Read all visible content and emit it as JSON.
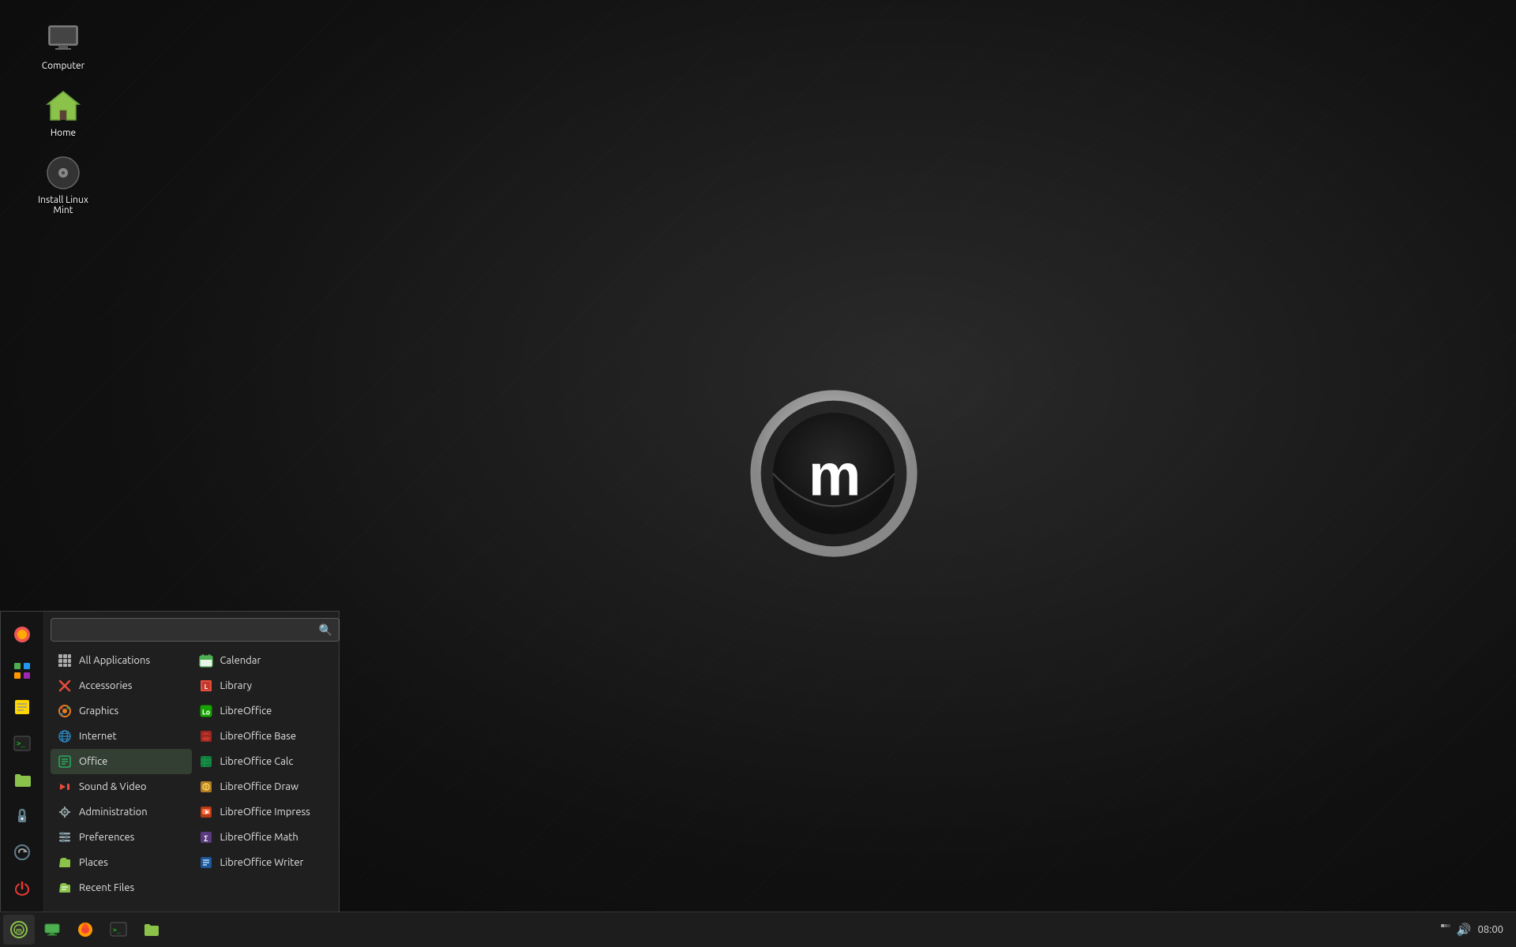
{
  "desktop": {
    "icons": [
      {
        "id": "computer",
        "label": "Computer",
        "icon": "🖥"
      },
      {
        "id": "home",
        "label": "Home",
        "icon": "🏠"
      },
      {
        "id": "install",
        "label": "Install Linux Mint",
        "icon": "💿"
      }
    ]
  },
  "taskbar": {
    "time": "08:00",
    "buttons": [
      {
        "id": "mint-menu",
        "icon": "🌿",
        "active": true
      },
      {
        "id": "show-desktop",
        "icon": "🟩",
        "active": false
      },
      {
        "id": "firefox",
        "icon": "🦊",
        "active": false
      },
      {
        "id": "terminal",
        "icon": "⬛",
        "active": false
      },
      {
        "id": "files",
        "icon": "📁",
        "active": false
      }
    ]
  },
  "startmenu": {
    "search_placeholder": "",
    "sidebar_icons": [
      {
        "id": "firefox-icon",
        "icon": "🦊"
      },
      {
        "id": "apps-icon",
        "icon": "⬛"
      },
      {
        "id": "sticky-icon",
        "icon": "🟨"
      },
      {
        "id": "terminal-icon",
        "icon": "⬛"
      },
      {
        "id": "folder-icon",
        "icon": "📁"
      },
      {
        "id": "lock-icon",
        "icon": "🔒"
      },
      {
        "id": "update-icon",
        "icon": "🔄"
      },
      {
        "id": "power-icon",
        "icon": "⏻"
      }
    ],
    "left_items": [
      {
        "id": "all-applications",
        "label": "All Applications",
        "icon": "grid",
        "active": false
      },
      {
        "id": "accessories",
        "label": "Accessories",
        "icon": "tools",
        "active": false
      },
      {
        "id": "graphics",
        "label": "Graphics",
        "icon": "graphics",
        "active": false
      },
      {
        "id": "internet",
        "label": "Internet",
        "icon": "internet",
        "active": false
      },
      {
        "id": "office",
        "label": "Office",
        "icon": "office",
        "active": true
      },
      {
        "id": "sound-video",
        "label": "Sound & Video",
        "icon": "sound",
        "active": false
      },
      {
        "id": "administration",
        "label": "Administration",
        "icon": "admin",
        "active": false
      },
      {
        "id": "preferences",
        "label": "Preferences",
        "icon": "prefs",
        "active": false
      },
      {
        "id": "places",
        "label": "Places",
        "icon": "places",
        "active": false
      },
      {
        "id": "recent-files",
        "label": "Recent Files",
        "icon": "recent",
        "active": false
      }
    ],
    "right_items": [
      {
        "id": "calendar",
        "label": "Calendar",
        "icon": "calendar"
      },
      {
        "id": "library",
        "label": "Library",
        "icon": "library"
      },
      {
        "id": "libreoffice",
        "label": "LibreOffice",
        "icon": "libreoffice"
      },
      {
        "id": "libreoffice-base",
        "label": "LibreOffice Base",
        "icon": "lo-base"
      },
      {
        "id": "libreoffice-calc",
        "label": "LibreOffice Calc",
        "icon": "lo-calc"
      },
      {
        "id": "libreoffice-draw",
        "label": "LibreOffice Draw",
        "icon": "lo-draw"
      },
      {
        "id": "libreoffice-impress",
        "label": "LibreOffice Impress",
        "icon": "lo-impress"
      },
      {
        "id": "libreoffice-math",
        "label": "LibreOffice Math",
        "icon": "lo-math"
      },
      {
        "id": "libreoffice-writer",
        "label": "LibreOffice Writer",
        "icon": "lo-writer"
      }
    ]
  }
}
